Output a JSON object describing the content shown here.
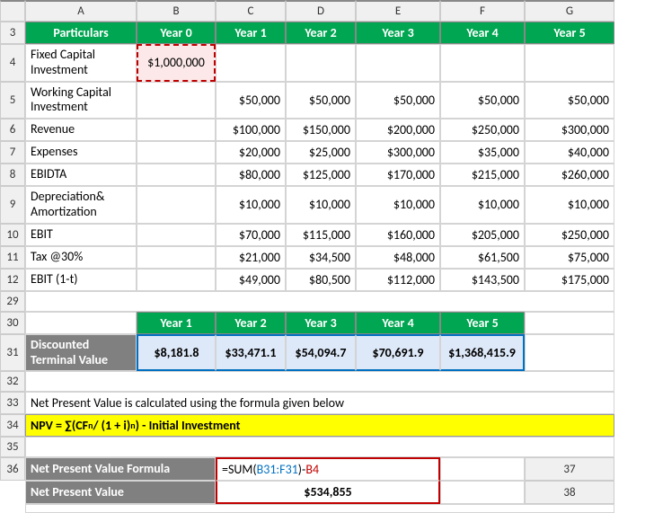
{
  "cols": {
    "rh": "",
    "A": "A",
    "B": "B",
    "C": "C",
    "D": "D",
    "E": "E",
    "F": "F",
    "G": "G"
  },
  "rownums": {
    "r3": "3",
    "r4": "4",
    "r5": "5",
    "r6": "6",
    "r7": "7",
    "r8": "8",
    "r9": "9",
    "r10": "10",
    "r11": "11",
    "r12": "12",
    "r29": "29",
    "r30": "30",
    "r31": "31",
    "r32": "32",
    "r33": "33",
    "r34": "34",
    "r35": "35",
    "r36": "36",
    "r37": "37",
    "r38": "38"
  },
  "hdr": {
    "particulars": "Particulars",
    "y0": "Year 0",
    "y1": "Year 1",
    "y2": "Year 2",
    "y3": "Year 3",
    "y4": "Year 4",
    "y5": "Year 5"
  },
  "rows": {
    "fci": {
      "label": "Fixed Capital Investment",
      "B": "$1,000,000"
    },
    "wci": {
      "label": "Working Capital Investment",
      "C": "$50,000",
      "D": "$50,000",
      "E": "$50,000",
      "F": "$50,000",
      "G": "$50,000"
    },
    "rev": {
      "label": "Revenue",
      "C": "$100,000",
      "D": "$150,000",
      "E": "$200,000",
      "F": "$250,000",
      "G": "$300,000"
    },
    "exp": {
      "label": "Expenses",
      "C": "$20,000",
      "D": "$25,000",
      "E": "$300,000",
      "F": "$35,000",
      "G": "$40,000"
    },
    "ebidta": {
      "label": "EBIDTA",
      "C": "$80,000",
      "D": "$125,000",
      "E": "$170,000",
      "F": "$215,000",
      "G": "$260,000"
    },
    "da": {
      "label": "Depreciation& Amortization",
      "C": "$10,000",
      "D": "$10,000",
      "E": "$10,000",
      "F": "$10,000",
      "G": "$10,000"
    },
    "ebit": {
      "label": "EBIT",
      "C": "$70,000",
      "D": "$115,000",
      "E": "$160,000",
      "F": "$205,000",
      "G": "$250,000"
    },
    "tax": {
      "label": "Tax @30%",
      "C": "$21,000",
      "D": "$34,500",
      "E": "$48,000",
      "F": "$61,500",
      "G": "$75,000"
    },
    "ebit1t": {
      "label": "EBIT (1-t)",
      "C": "$49,000",
      "D": "$80,500",
      "E": "$112,000",
      "F": "$143,500",
      "G": "$175,000"
    }
  },
  "dtv": {
    "label": "Discounted Terminal Value",
    "y1": "$8,181.8",
    "y2": "$33,471.1",
    "y3": "$54,094.7",
    "y4": "$70,691.9",
    "y5": "$1,368,415.9"
  },
  "note33": "Net Present Value is calculated using the formula given below",
  "npv_formula_text": {
    "pre": "NPV = ∑(CF",
    "sub1": "n",
    "mid": " / (1 + i)",
    "sup1": "n",
    "post": ") - Initial Investment"
  },
  "npvf": {
    "label": "Net Present Value Formula",
    "eq_pre": "=SUM(",
    "range": "B31:F31",
    "close": ")",
    "sep": "-",
    "ref": "B4"
  },
  "npv": {
    "label": "Net Present Value",
    "value": "$534,855"
  }
}
